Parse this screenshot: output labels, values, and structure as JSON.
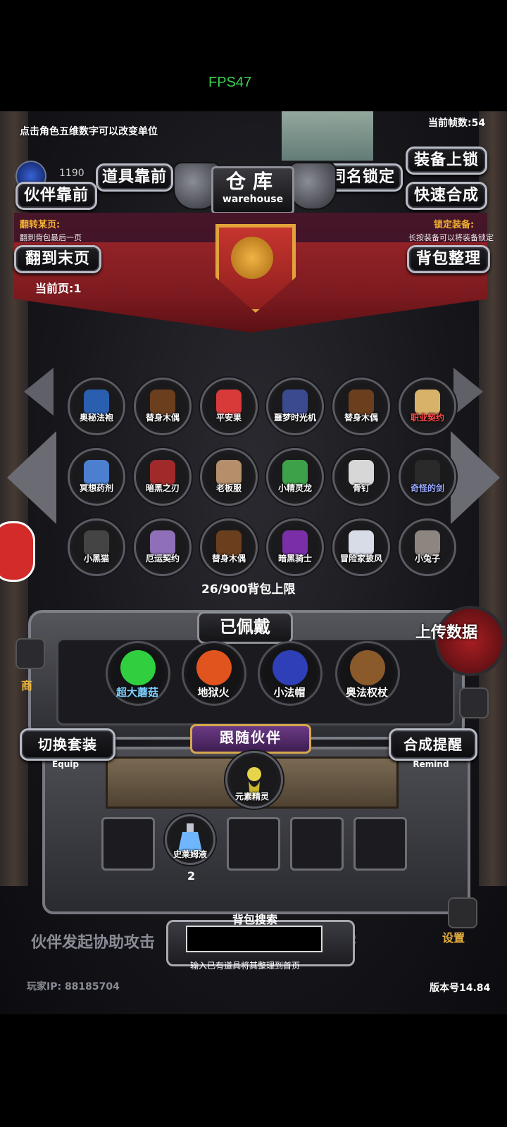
{
  "overlay": {
    "fps": "FPS47"
  },
  "top": {
    "hint": "点击角色五维数字可以改变单位",
    "frame_rate": "当前帧数:54",
    "gems": "1190"
  },
  "buttons": {
    "items_front": "道具靠前",
    "partner_front": "伙伴靠前",
    "same_name_lock": "同名锁定",
    "equip_lock": "装备上锁",
    "quick_merge": "快速合成",
    "flip_last": "翻到末页",
    "bag_sort": "背包整理"
  },
  "title": {
    "cn": "仓库",
    "en": "warehouse"
  },
  "banner": {
    "flip_label": "翻转某页:",
    "flip_sub": "翻到背包最后一页",
    "lock_label": "锁定装备:",
    "lock_sub": "长按装备可以将装备锁定"
  },
  "page": {
    "current": "当前页:1"
  },
  "inventory": {
    "items": [
      {
        "label": "奥秘法袍",
        "icon": "robe-icon",
        "color": "#ffffff"
      },
      {
        "label": "替身木偶",
        "icon": "wood-puppet-icon",
        "color": "#ffffff"
      },
      {
        "label": "平安果",
        "icon": "apple-icon",
        "color": "#ffffff"
      },
      {
        "label": "噩梦时光机",
        "icon": "time-machine-icon",
        "color": "#ffffff"
      },
      {
        "label": "替身木偶",
        "icon": "wood-puppet-icon",
        "color": "#ffffff"
      },
      {
        "label": "职业契约",
        "icon": "scroll-icon",
        "color": "#ff4d4d"
      },
      {
        "label": "冥想药剂",
        "icon": "potion-icon",
        "color": "#ffffff"
      },
      {
        "label": "暗黑之刃",
        "icon": "dark-blade-icon",
        "color": "#ffffff"
      },
      {
        "label": "老板服",
        "icon": "boss-suit-icon",
        "color": "#ffffff"
      },
      {
        "label": "小精灵龙",
        "icon": "fairy-dragon-icon",
        "color": "#ffffff"
      },
      {
        "label": "骨钉",
        "icon": "bone-nail-icon",
        "color": "#ffffff"
      },
      {
        "label": "奇怪的剑",
        "icon": "strange-sword-icon",
        "color": "#9aa8ff"
      },
      {
        "label": "小黑猫",
        "icon": "black-cat-icon",
        "color": "#ffffff"
      },
      {
        "label": "厄运契约",
        "icon": "doom-contract-icon",
        "color": "#ffffff"
      },
      {
        "label": "替身木偶",
        "icon": "wood-puppet-icon",
        "color": "#ffffff"
      },
      {
        "label": "暗黑骑士",
        "icon": "dark-knight-icon",
        "color": "#ffffff"
      },
      {
        "label": "冒险家披风",
        "icon": "cloak-icon",
        "color": "#ffffff"
      },
      {
        "label": "小兔子",
        "icon": "rabbit-icon",
        "color": "#ffffff"
      }
    ],
    "capacity": "26/900背包上限"
  },
  "worn": {
    "title": "已佩戴",
    "items": [
      {
        "label": "超大蘑菇",
        "icon": "mushroom-icon",
        "color": "#7fd0ff"
      },
      {
        "label": "地狱火",
        "icon": "hellfire-icon",
        "color": "#ffffff"
      },
      {
        "label": "小法帽",
        "icon": "wizard-hat-icon",
        "color": "#ffffff"
      },
      {
        "label": "奥法权杖",
        "icon": "staff-icon",
        "color": "#ffffff"
      }
    ]
  },
  "upload": {
    "label": "上传数据"
  },
  "switch": {
    "cn": "切换套装",
    "en": "Equip"
  },
  "remind": {
    "cn": "合成提醒",
    "en": "Remind"
  },
  "follow": {
    "title": "跟随伙伴",
    "partner": {
      "label": "元素精灵",
      "icon": "elemental-sprite-icon"
    }
  },
  "consumables": {
    "slot2": {
      "label": "史莱姆液",
      "icon": "slime-potion-icon",
      "qty": "2"
    }
  },
  "search": {
    "title": "背包搜索",
    "value": "",
    "hint": "输入已有道具将其整理到首页"
  },
  "footer": {
    "ticker": "伙伴发起协助攻击",
    "ticker_end": "害",
    "ip": "玩家IP:  88185704",
    "version": "版本号14.84",
    "shop": "商",
    "settings": "设置"
  }
}
